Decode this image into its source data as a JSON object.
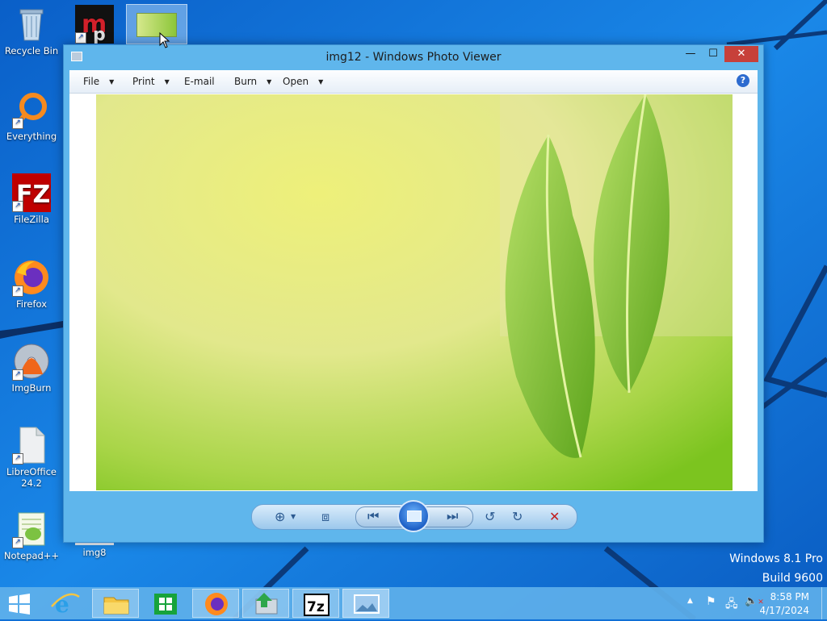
{
  "desktop": {
    "icons": [
      {
        "label": "Recycle Bin"
      },
      {
        "label": "Everything"
      },
      {
        "label": "FileZilla"
      },
      {
        "label": "Firefox"
      },
      {
        "label": "ImgBurn"
      },
      {
        "label": "LibreOffice 24.2"
      },
      {
        "label": "Notepad++"
      },
      {
        "label": "img8"
      }
    ],
    "watermark": {
      "edition": "Windows 8.1 Pro",
      "build": "Build 9600"
    }
  },
  "window": {
    "title": "img12 - Windows Photo Viewer",
    "menu": [
      {
        "label": "File",
        "dropdown": true
      },
      {
        "label": "Print",
        "dropdown": true
      },
      {
        "label": "E-mail",
        "dropdown": false
      },
      {
        "label": "Burn",
        "dropdown": true
      },
      {
        "label": "Open",
        "dropdown": true
      }
    ],
    "help_glyph": "?"
  },
  "taskbar": {
    "apps": [
      "start",
      "internet-explorer",
      "file-explorer",
      "store",
      "firefox",
      "file-transfer",
      "7zip",
      "photo-viewer"
    ],
    "active_app": "photo-viewer",
    "clock": {
      "time": "8:58 PM",
      "date": "4/17/2024"
    }
  },
  "colors": {
    "taskbar": "#5eb0ea",
    "window_frame": "#5fb6ec",
    "close_button": "#c7403a",
    "desktop": "#0f6fd6"
  }
}
